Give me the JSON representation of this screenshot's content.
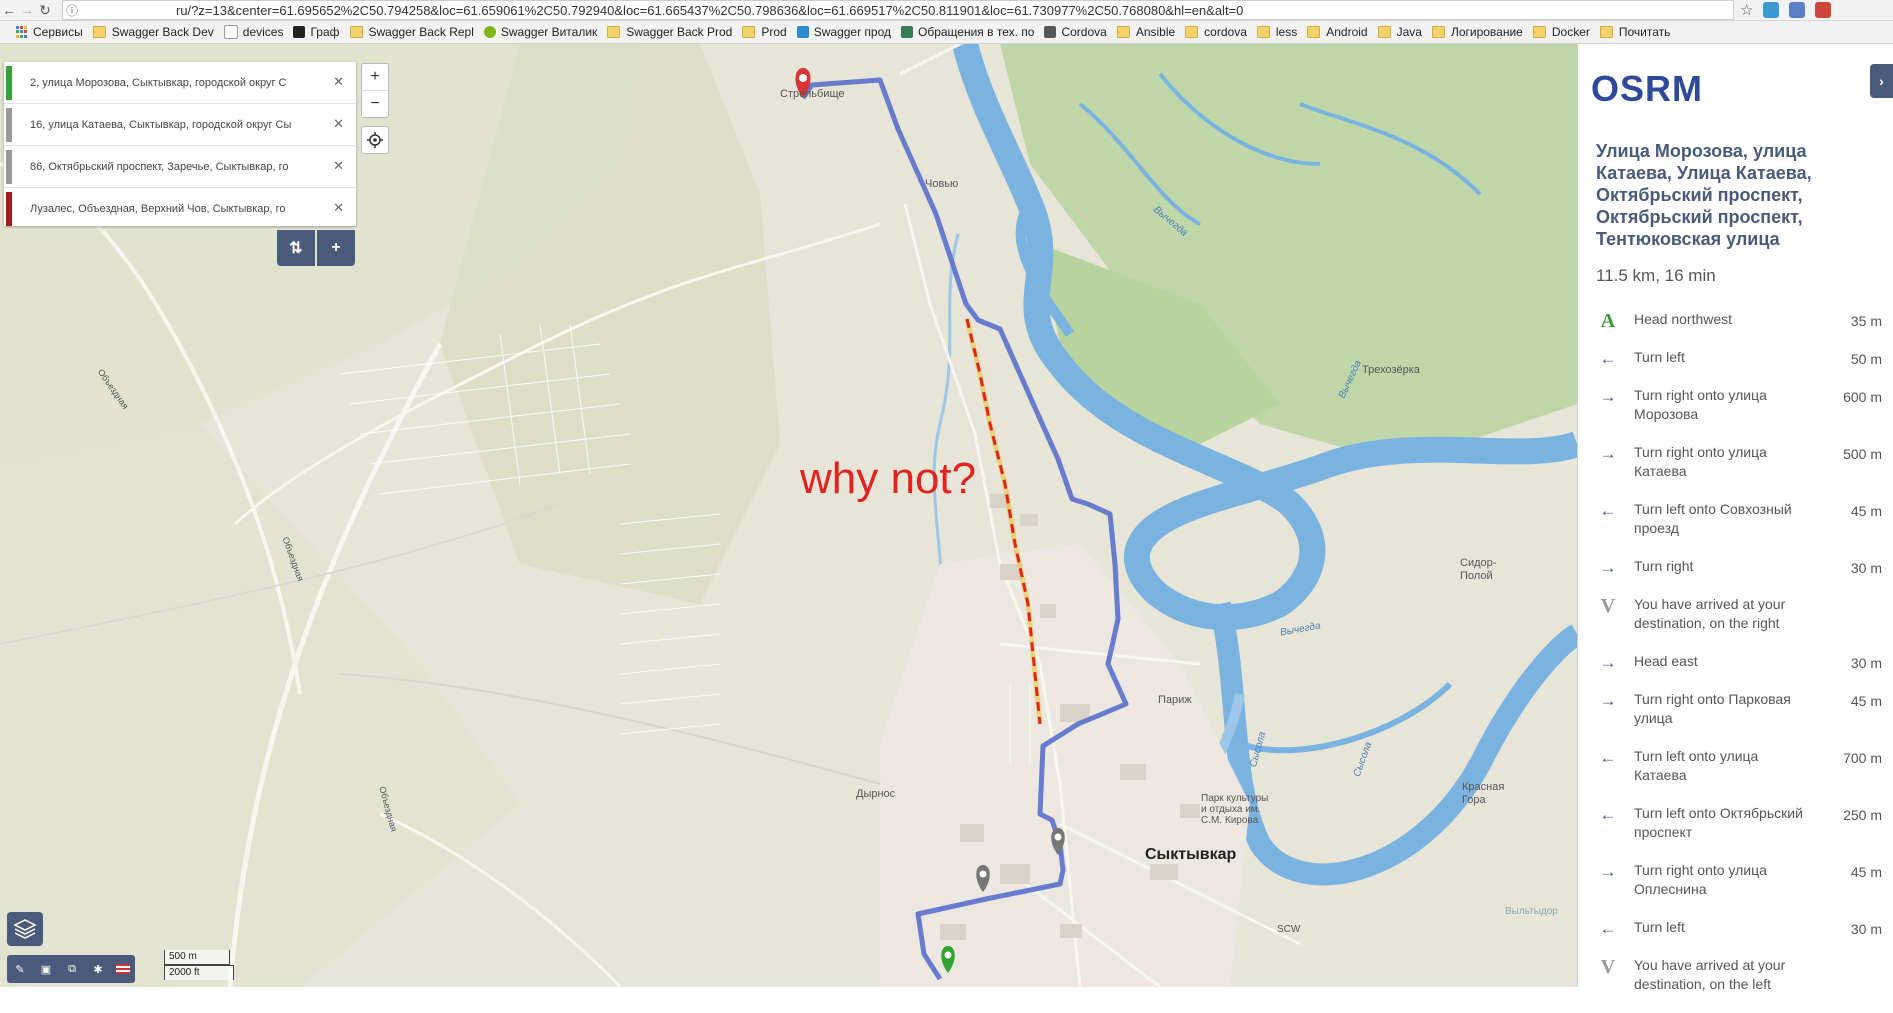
{
  "browser": {
    "url": "ru/?z=13&center=61.695652%2C50.794258&loc=61.659061%2C50.792940&loc=61.665437%2C50.798636&loc=61.669517%2C50.811901&loc=61.730977%2C50.768080&hl=en&alt=0",
    "bookmarks": [
      {
        "label": "Сервисы",
        "icon": "apps-icon"
      },
      {
        "label": "Swagger Back Dev",
        "icon": "folder-icon"
      },
      {
        "label": "devices",
        "icon": "page-icon"
      },
      {
        "label": "Граф",
        "icon": "inv-icon"
      },
      {
        "label": "Swagger Back Repl",
        "icon": "folder-icon"
      },
      {
        "label": "Swagger Виталик",
        "icon": "swagger-icon"
      },
      {
        "label": "Swagger Back Prod",
        "icon": "folder-icon"
      },
      {
        "label": "Prod",
        "icon": "folder-icon"
      },
      {
        "label": "Swagger прод",
        "icon": "sail-icon"
      },
      {
        "label": "Обращения в тех. по",
        "icon": "v-icon"
      },
      {
        "label": "Cordova",
        "icon": "cordova-icon"
      },
      {
        "label": "Ansible",
        "icon": "folder-icon"
      },
      {
        "label": "cordova",
        "icon": "folder-icon"
      },
      {
        "label": "less",
        "icon": "folder-icon"
      },
      {
        "label": "Android",
        "icon": "folder-icon"
      },
      {
        "label": "Java",
        "icon": "folder-icon"
      },
      {
        "label": "Логирование",
        "icon": "folder-icon"
      },
      {
        "label": "Docker",
        "icon": "folder-icon"
      },
      {
        "label": "Почитать",
        "icon": "folder-icon"
      }
    ]
  },
  "waypoints": [
    {
      "label": "2, улица Морозова, Сыктывкар, городской округ С",
      "color": "#34a534"
    },
    {
      "label": "16, улица Катаева, Сыктывкар, городской округ Сы",
      "color": "#999999"
    },
    {
      "label": "86, Октябрьский проспект, Заречье, Сыктывкар, го",
      "color": "#999999"
    },
    {
      "label": "Лузалес, Объездная, Верхний Чов, Сыктывкар, го",
      "color": "#a01c1c"
    }
  ],
  "controls": {
    "reverse": "⇅",
    "add": "+",
    "zoom_in": "+",
    "zoom_out": "−",
    "scale_metric": "500 m",
    "scale_imperial": "2000 ft"
  },
  "annotation": "why not?",
  "map_labels": {
    "strelnichye": "Стрельбище",
    "chovyu": "Човью",
    "trekhozerka": "Трехозёрка",
    "sidor_poloy": "Сидор-\nПолой",
    "parizh": "Париж",
    "dyrnos": "Дырнос",
    "syktyvkar": "Сыктывкар",
    "park": "Парк культуры\nи отдыха им.\nС.М. Кирова",
    "krasnaya_gora": "Красная\nГора",
    "vychegda": "Вычегда",
    "sysola": "Сысола",
    "obezdnaya": "Объездная",
    "scw": "SCW",
    "vylyttdor": "Выльтыдор"
  },
  "sidebar": {
    "logo": "OSRM",
    "route_name": "Улица Морозова, улица Катаева, Улица Катаева, Октябрьский проспект, Октябрьский проспект, Тентюковская улица",
    "summary": "11.5 km, 16 min",
    "steps": [
      {
        "icon": "A",
        "text": "Head northwest",
        "dist": "35 m"
      },
      {
        "icon": "←",
        "text": "Turn left",
        "dist": "50 m"
      },
      {
        "icon": "→",
        "text": "Turn right onto улица Морозова",
        "dist": "600 m"
      },
      {
        "icon": "→",
        "text": "Turn right onto улица Катаева",
        "dist": "500 m"
      },
      {
        "icon": "←",
        "text": "Turn left onto Совхозный проезд",
        "dist": "45 m"
      },
      {
        "icon": "→",
        "text": "Turn right",
        "dist": "30 m"
      },
      {
        "icon": "V",
        "text": "You have arrived at your destination, on the right",
        "dist": ""
      },
      {
        "icon": "→",
        "text": "Head east",
        "dist": "30 m"
      },
      {
        "icon": "→",
        "text": "Turn right onto Парковая улица",
        "dist": "45 m"
      },
      {
        "icon": "←",
        "text": "Turn left onto улица Катаева",
        "dist": "700 m"
      },
      {
        "icon": "←",
        "text": "Turn left onto Октябрьский проспект",
        "dist": "250 m"
      },
      {
        "icon": "→",
        "text": "Turn right onto улица Оплеснина",
        "dist": "45 m"
      },
      {
        "icon": "←",
        "text": "Turn left",
        "dist": "30 m"
      },
      {
        "icon": "V",
        "text": "You have arrived at your destination, on the left",
        "dist": ""
      }
    ]
  },
  "colors": {
    "route": "#5b6fcc",
    "river": "#7bb3e0",
    "accent": "#4a5a7a",
    "annotation": "#e0231f"
  }
}
